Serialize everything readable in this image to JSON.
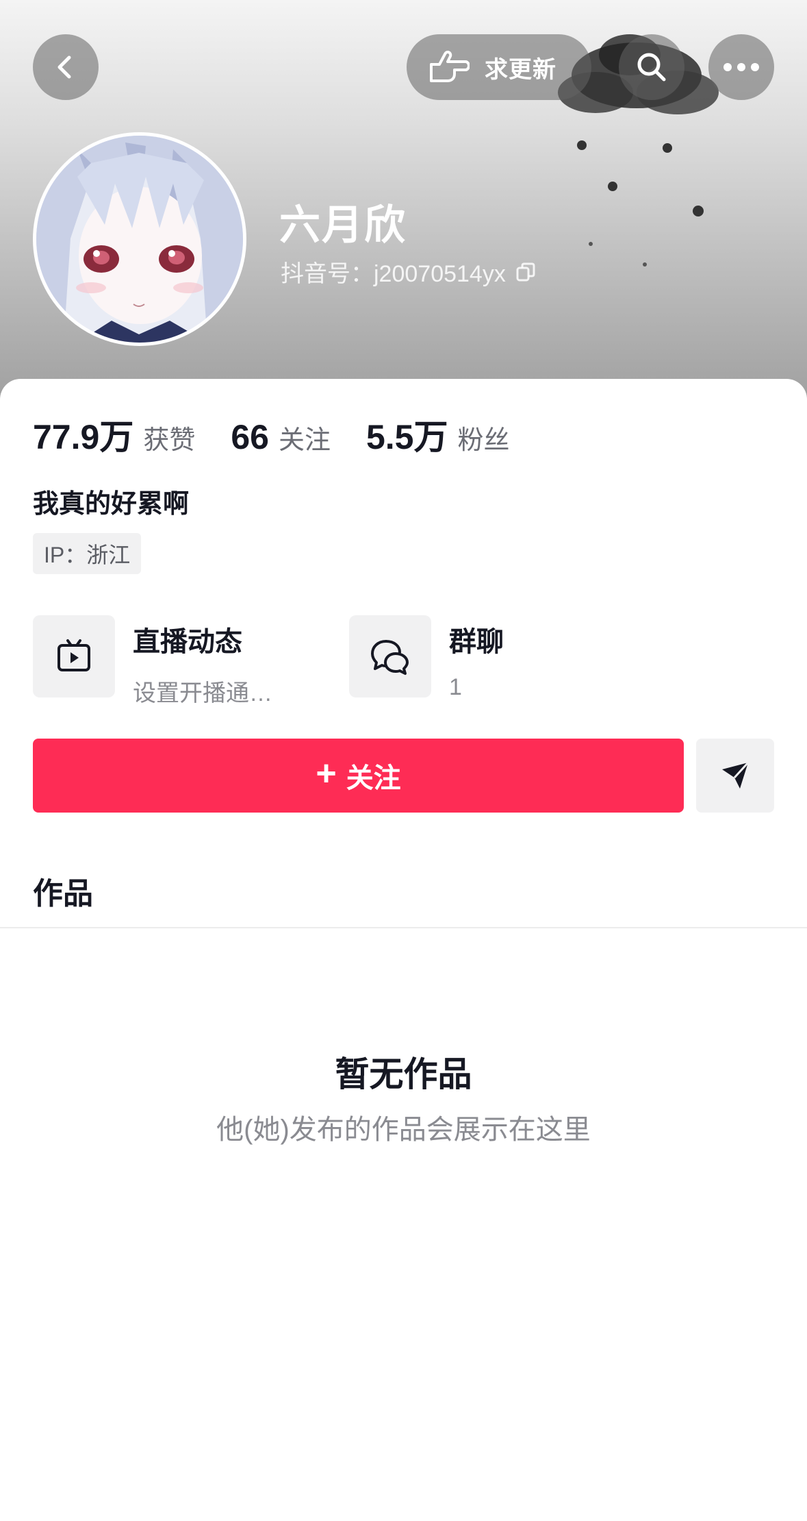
{
  "topbar": {
    "request_update_label": "求更新"
  },
  "profile": {
    "nickname": "六月欣",
    "douyin_id": "抖音号：j20070514yx",
    "bio": "我真的好累啊",
    "ip_location": "IP：浙江"
  },
  "stats": [
    {
      "value": "77.9万",
      "label": "获赞"
    },
    {
      "value": "66",
      "label": "关注"
    },
    {
      "value": "5.5万",
      "label": "粉丝"
    }
  ],
  "entries": [
    {
      "title": "直播动态",
      "subtitle": "设置开播通…",
      "icon": "tv-icon"
    },
    {
      "title": "群聊",
      "subtitle": "1",
      "icon": "chat-bubbles-icon"
    }
  ],
  "actions": {
    "follow_label": "关注",
    "follow_prefix": "+"
  },
  "tabs": {
    "works_label": "作品"
  },
  "empty_state": {
    "title": "暂无作品",
    "subtitle": "他(她)发布的作品会展示在这里"
  },
  "colors": {
    "primary_red": "#fe2c55",
    "text_dark": "#161823",
    "text_gray": "#8a8b91"
  }
}
